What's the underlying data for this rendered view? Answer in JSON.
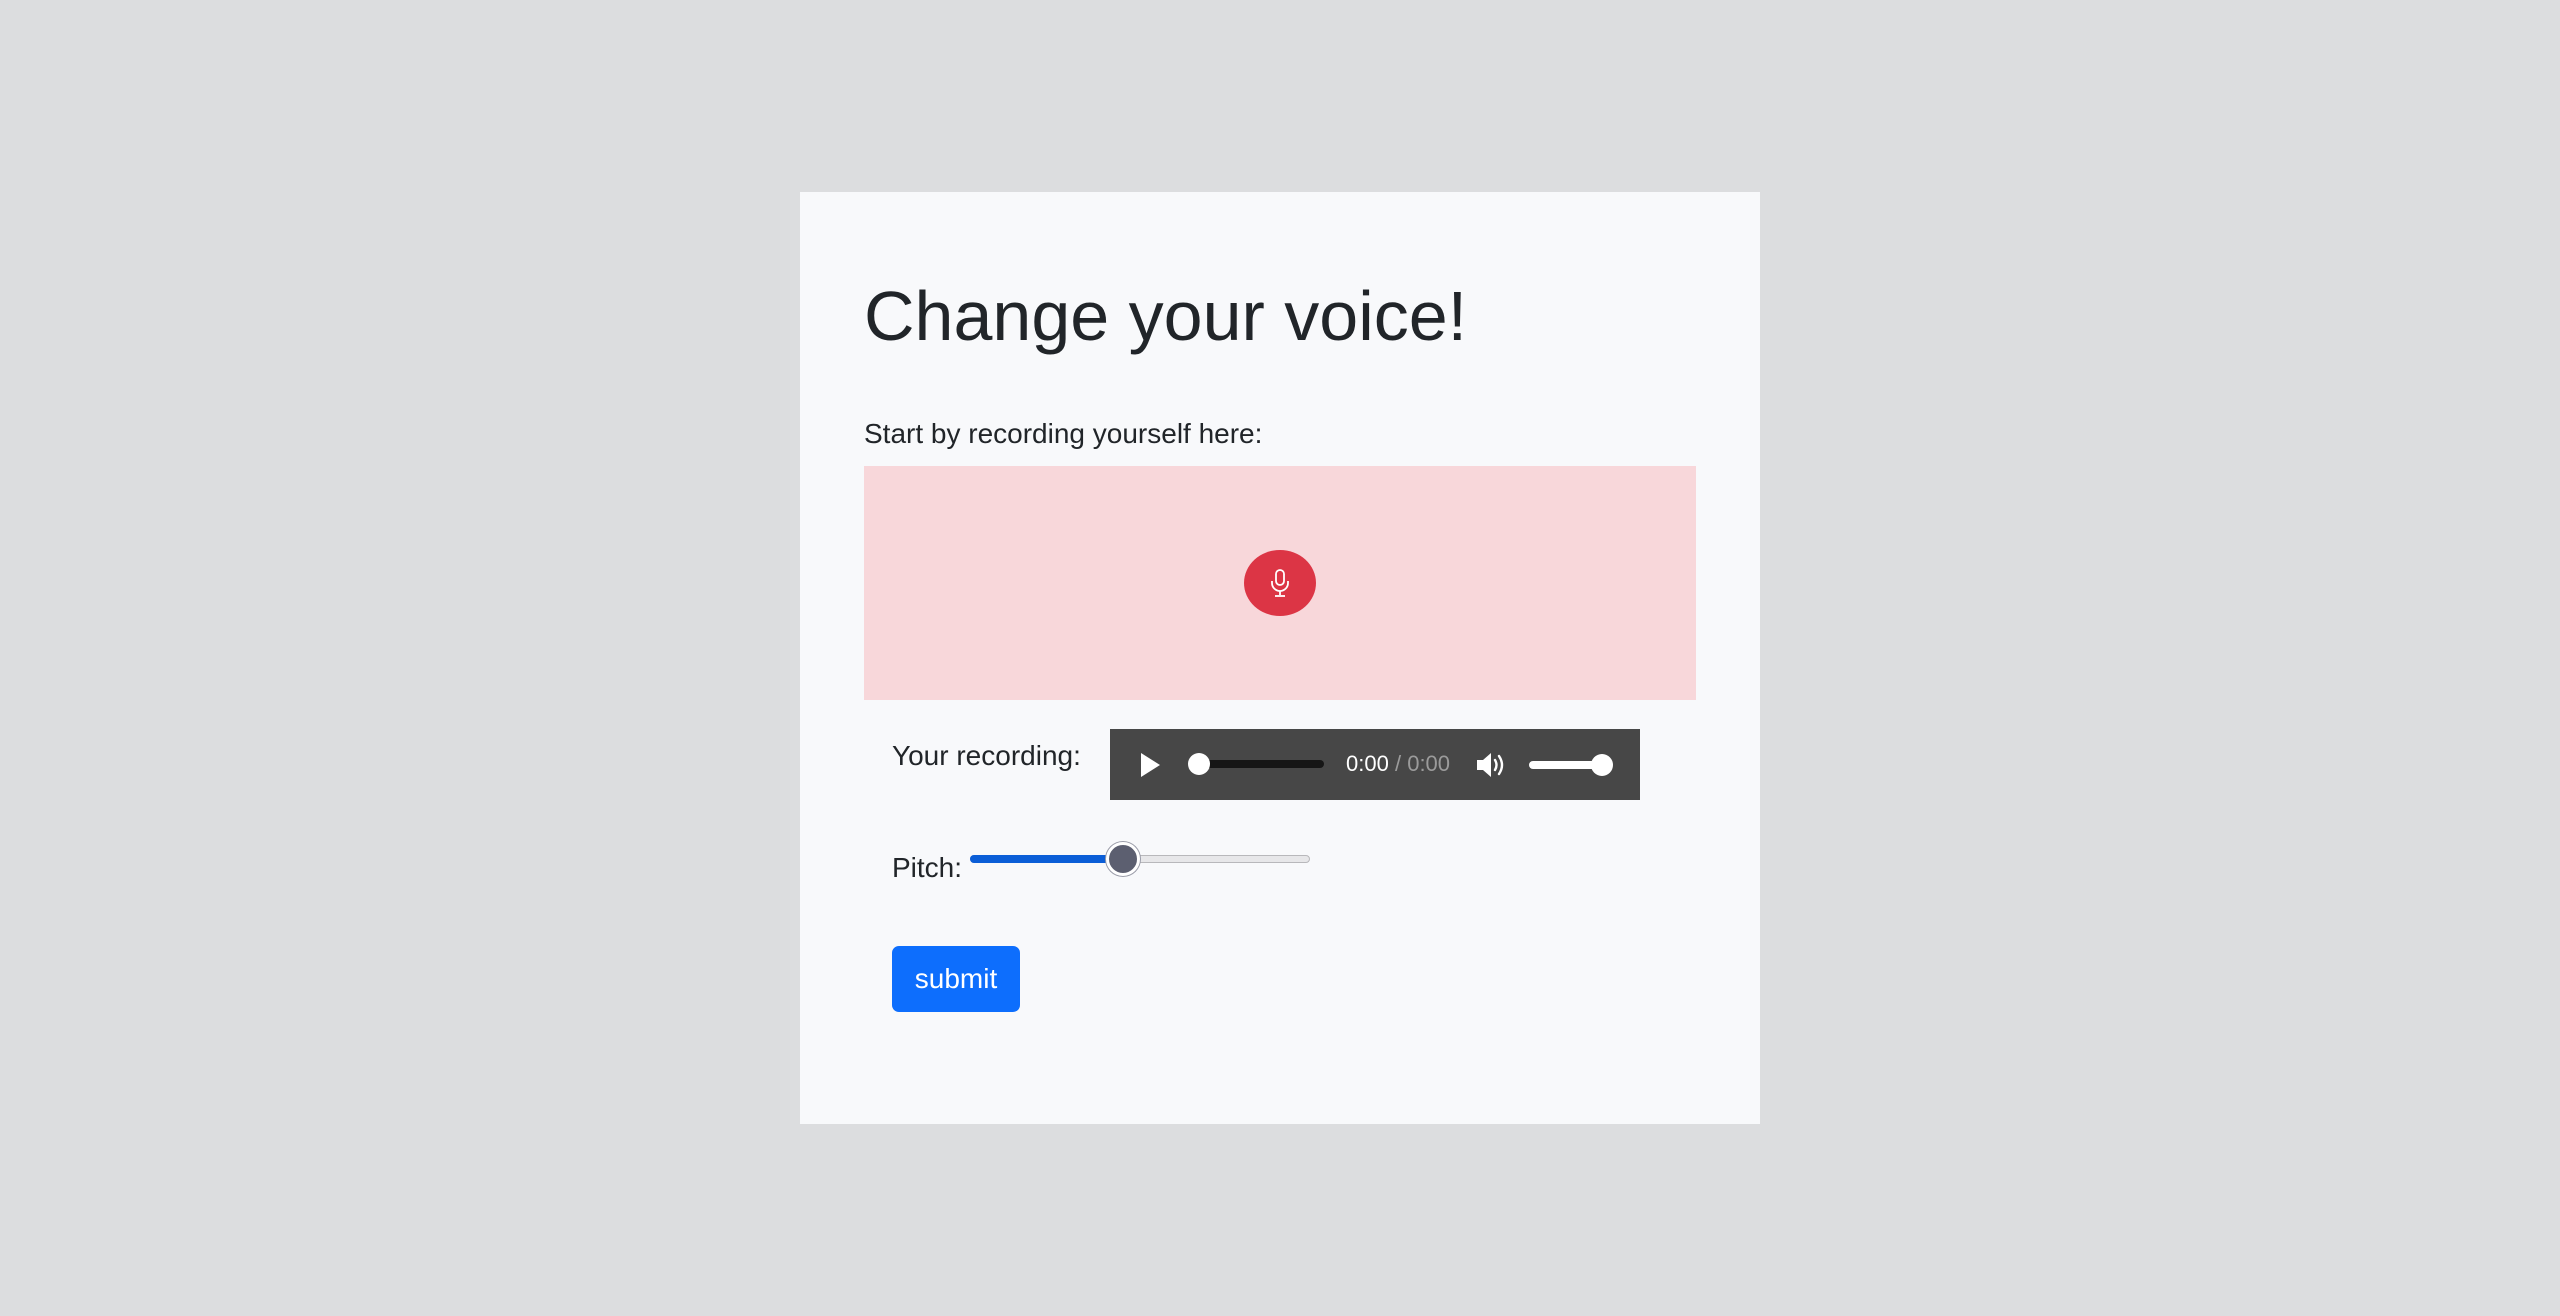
{
  "page": {
    "title": "Change your voice!",
    "intro": "Start by recording yourself here:"
  },
  "recorder": {
    "icon": "microphone-icon",
    "accent_color": "#dc3545",
    "box_color": "#f8d7da"
  },
  "playback": {
    "label": "Your recording:",
    "current_time": "0:00",
    "separator": "/",
    "duration": "0:00",
    "progress": 0,
    "volume": 1.0,
    "play_icon": "play-icon",
    "volume_icon": "volume-icon"
  },
  "pitch": {
    "label": "Pitch:",
    "value_fraction": 0.45
  },
  "submit": {
    "label": "submit",
    "color": "#0d6efd"
  }
}
